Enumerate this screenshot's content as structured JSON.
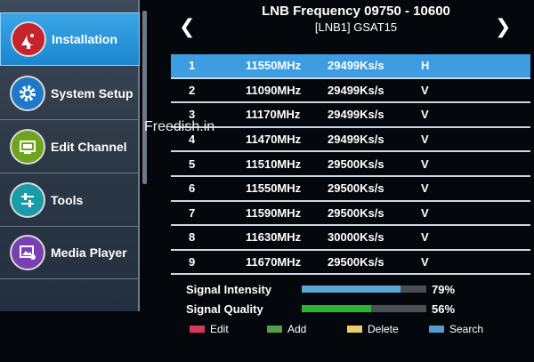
{
  "header": {
    "title": "LNB Frequency 09750 - 10600",
    "subtitle": "[LNB1] GSAT15",
    "prev_arrow": "❮",
    "next_arrow": "❯"
  },
  "sidebar": {
    "items": [
      {
        "label": "Installation",
        "icon": "satellite-dish-icon",
        "active": true,
        "icon_color": "#c5232d"
      },
      {
        "label": "System Setup",
        "icon": "gear-icon",
        "active": false,
        "icon_color": "#1f79c6"
      },
      {
        "label": "Edit Channel",
        "icon": "tv-edit-icon",
        "active": false,
        "icon_color": "#6ea51c"
      },
      {
        "label": "Tools",
        "icon": "tools-icon",
        "active": false,
        "icon_color": "#1b9aa8"
      },
      {
        "label": "Media Player",
        "icon": "media-player-icon",
        "active": false,
        "icon_color": "#7b3eb2"
      }
    ]
  },
  "watermark": "Freedish.in",
  "transponders": [
    {
      "index": "1",
      "freq": "11550MHz",
      "symbol": "29499Ks/s",
      "pol": "H"
    },
    {
      "index": "2",
      "freq": "11090MHz",
      "symbol": "29499Ks/s",
      "pol": "V"
    },
    {
      "index": "3",
      "freq": "11170MHz",
      "symbol": "29499Ks/s",
      "pol": "V"
    },
    {
      "index": "4",
      "freq": "11470MHz",
      "symbol": "29499Ks/s",
      "pol": "V"
    },
    {
      "index": "5",
      "freq": "11510MHz",
      "symbol": "29500Ks/s",
      "pol": "V"
    },
    {
      "index": "6",
      "freq": "11550MHz",
      "symbol": "29500Ks/s",
      "pol": "V"
    },
    {
      "index": "7",
      "freq": "11590MHz",
      "symbol": "29500Ks/s",
      "pol": "V"
    },
    {
      "index": "8",
      "freq": "11630MHz",
      "symbol": "30000Ks/s",
      "pol": "V"
    },
    {
      "index": "9",
      "freq": "11670MHz",
      "symbol": "29500Ks/s",
      "pol": "V"
    }
  ],
  "selected_row": 0,
  "signal": {
    "intensity": {
      "label": "Signal Intensity",
      "value": "79%",
      "percent": 79,
      "color": "#5aa7d6"
    },
    "quality": {
      "label": "Signal Quality",
      "value": "56%",
      "percent": 56,
      "color": "#27b534"
    }
  },
  "legend": [
    {
      "label": "Edit",
      "color": "#d8385a"
    },
    {
      "label": "Add",
      "color": "#56a046"
    },
    {
      "label": "Delete",
      "color": "#e8cf6a"
    },
    {
      "label": "Search",
      "color": "#4f9ecf"
    }
  ]
}
